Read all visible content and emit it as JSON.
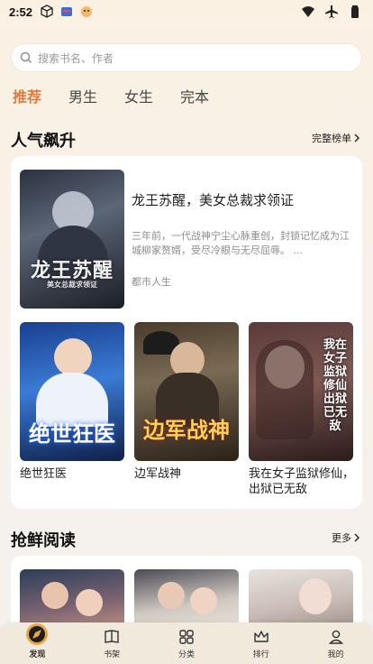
{
  "status_bar": {
    "time": "2:52"
  },
  "search": {
    "placeholder": "搜索书名、作者"
  },
  "tabs": [
    {
      "label": "推荐",
      "active": true
    },
    {
      "label": "男生",
      "active": false
    },
    {
      "label": "女生",
      "active": false
    },
    {
      "label": "完本",
      "active": false
    }
  ],
  "popular": {
    "title": "人气飙升",
    "more": "完整榜单",
    "featured": {
      "title": "龙王苏醒，美女总裁求领证",
      "description": "三年前，一代战神宁尘心脉重创，封锁记忆成为江城柳家赘婿，受尽冷眼与无尽屈辱。 ...",
      "tag": "都市人生",
      "cover_text": "龙王苏醒",
      "cover_sub": "美女总裁求领证"
    },
    "books": [
      {
        "title": "绝世狂医",
        "cover_text": "绝世狂医"
      },
      {
        "title": "边军战神",
        "cover_text": "边军战神"
      },
      {
        "title": "我在女子监狱修仙，出狱已无敌",
        "cover_text": "我在女子监狱修仙 出狱已无敌"
      }
    ]
  },
  "fresh": {
    "title": "抢鲜阅读",
    "more": "更多"
  },
  "colors": {
    "accent": "#e07a3a"
  },
  "bottom_nav": [
    {
      "label": "发现",
      "icon": "discover-icon",
      "active": true
    },
    {
      "label": "书架",
      "icon": "bookshelf-icon",
      "active": false
    },
    {
      "label": "分类",
      "icon": "category-icon",
      "active": false
    },
    {
      "label": "排行",
      "icon": "ranking-icon",
      "active": false
    },
    {
      "label": "我的",
      "icon": "profile-icon",
      "active": false
    }
  ]
}
